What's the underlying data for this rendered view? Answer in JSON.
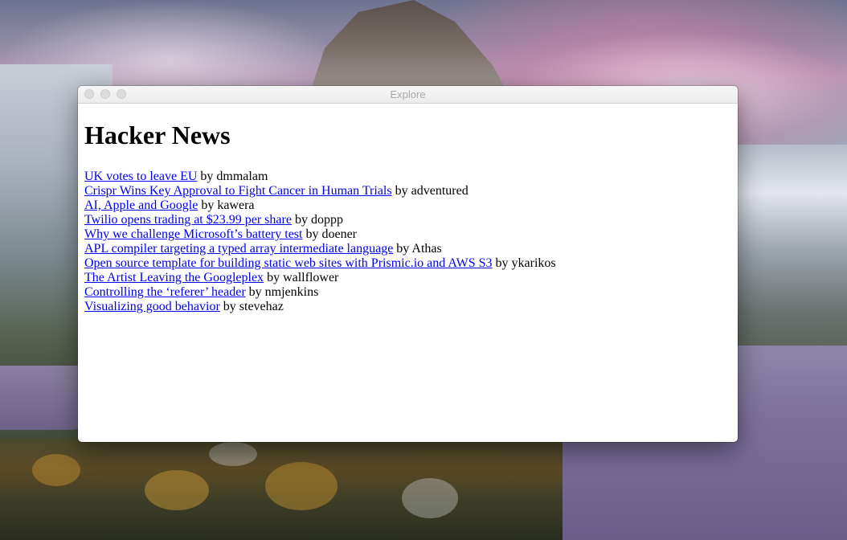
{
  "window": {
    "title": "Explore"
  },
  "page": {
    "heading": "Hacker News",
    "by_word": "by"
  },
  "stories": [
    {
      "title": "UK votes to leave EU",
      "author": "dmmalam"
    },
    {
      "title": "Crispr Wins Key Approval to Fight Cancer in Human Trials",
      "author": "adventured"
    },
    {
      "title": "AI, Apple and Google",
      "author": "kawera"
    },
    {
      "title": "Twilio opens trading at $23.99 per share",
      "author": "doppp"
    },
    {
      "title": "Why we challenge Microsoft’s battery test",
      "author": "doener"
    },
    {
      "title": "APL compiler targeting a typed array intermediate language",
      "author": "Athas"
    },
    {
      "title": "Open source template for building static web sites with Prismic.io and AWS S3",
      "author": "ykarikos"
    },
    {
      "title": "The Artist Leaving the Googleplex",
      "author": "wallflower"
    },
    {
      "title": "Controlling the ‘referer’ header",
      "author": "nmjenkins"
    },
    {
      "title": "Visualizing good behavior",
      "author": "stevehaz"
    }
  ],
  "colors": {
    "link": "#0000ee",
    "text": "#000000",
    "window_title": "#a9a9a9",
    "traffic_light_inactive": "#dcdcdc"
  }
}
